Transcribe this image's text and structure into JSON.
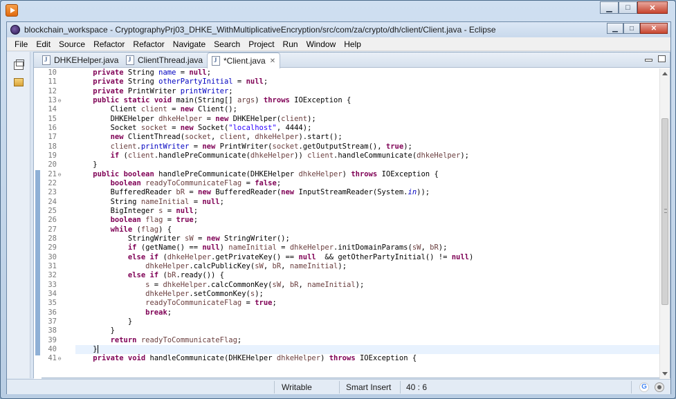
{
  "eclipse": {
    "title": "blockchain_workspace - CryptographyPrj03_DHKE_WithMultiplicativeEncryption/src/com/za/crypto/dh/client/Client.java - Eclipse"
  },
  "menu": [
    "File",
    "Edit",
    "Source",
    "Refactor",
    "Refactor",
    "Navigate",
    "Search",
    "Project",
    "Run",
    "Window",
    "Help"
  ],
  "tabs": [
    {
      "label": "DHKEHelper.java",
      "active": false
    },
    {
      "label": "ClientThread.java",
      "active": false
    },
    {
      "label": "*Client.java",
      "active": true,
      "close": "✕"
    }
  ],
  "editor": {
    "current_line": 40,
    "lines": [
      {
        "n": "10",
        "fold": "",
        "code": "    private String name = null;"
      },
      {
        "n": "11",
        "fold": "",
        "code": "    private String otherPartyInitial = null;"
      },
      {
        "n": "12",
        "fold": "",
        "code": "    private PrintWriter printWriter;"
      },
      {
        "n": "13",
        "fold": "⊖",
        "code": "    public static void main(String[] args) throws IOException {"
      },
      {
        "n": "14",
        "fold": "",
        "code": "        Client client = new Client();"
      },
      {
        "n": "15",
        "fold": "",
        "code": "        DHKEHelper dhkeHelper = new DHKEHelper(client);"
      },
      {
        "n": "16",
        "fold": "",
        "code": "        Socket socket = new Socket(\"localhost\", 4444);"
      },
      {
        "n": "17",
        "fold": "",
        "code": "        new ClientThread(socket, client, dhkeHelper).start();"
      },
      {
        "n": "18",
        "fold": "",
        "code": "        client.printWriter = new PrintWriter(socket.getOutputStream(), true);"
      },
      {
        "n": "19",
        "fold": "",
        "code": "        if (client.handlePreCommunicate(dhkeHelper)) client.handleCommunicate(dhkeHelper);"
      },
      {
        "n": "20",
        "fold": "",
        "code": "    }"
      },
      {
        "n": "21",
        "fold": "⊖",
        "code": "    public boolean handlePreCommunicate(DHKEHelper dhkeHelper) throws IOException {"
      },
      {
        "n": "22",
        "fold": "",
        "code": "        boolean readyToCommunicateFlag = false;"
      },
      {
        "n": "23",
        "fold": "",
        "code": "        BufferedReader bR = new BufferedReader(new InputStreamReader(System.in));"
      },
      {
        "n": "24",
        "fold": "",
        "code": "        String nameInitial = null;"
      },
      {
        "n": "25",
        "fold": "",
        "code": "        BigInteger s = null;"
      },
      {
        "n": "26",
        "fold": "",
        "code": "        boolean flag = true;"
      },
      {
        "n": "27",
        "fold": "",
        "code": "        while (flag) {"
      },
      {
        "n": "28",
        "fold": "",
        "code": "            StringWriter sW = new StringWriter();"
      },
      {
        "n": "29",
        "fold": "",
        "code": "            if (getName() == null) nameInitial = dhkeHelper.initDomainParams(sW, bR);"
      },
      {
        "n": "30",
        "fold": "",
        "code": "            else if (dhkeHelper.getPrivateKey() == null  && getOtherPartyInitial() != null)"
      },
      {
        "n": "31",
        "fold": "",
        "code": "                dhkeHelper.calcPublicKey(sW, bR, nameInitial);"
      },
      {
        "n": "32",
        "fold": "",
        "code": "            else if (bR.ready()) {"
      },
      {
        "n": "33",
        "fold": "",
        "code": "                s = dhkeHelper.calcCommonKey(sW, bR, nameInitial);"
      },
      {
        "n": "34",
        "fold": "",
        "code": "                dhkeHelper.setCommonKey(s);"
      },
      {
        "n": "35",
        "fold": "",
        "code": "                readyToCommunicateFlag = true;"
      },
      {
        "n": "36",
        "fold": "",
        "code": "                break;"
      },
      {
        "n": "37",
        "fold": "",
        "code": "            }"
      },
      {
        "n": "38",
        "fold": "",
        "code": "        }"
      },
      {
        "n": "39",
        "fold": "",
        "code": "        return readyToCommunicateFlag;"
      },
      {
        "n": "40",
        "fold": "",
        "code": "    }"
      },
      {
        "n": "41",
        "fold": "⊖",
        "code": "    private void handleCommunicate(DHKEHelper dhkeHelper) throws IOException {"
      }
    ]
  },
  "status": {
    "mode": "Writable",
    "insert": "Smart Insert",
    "position": "40 : 6"
  },
  "icons": {
    "outer_app": "recorder-app-icon",
    "eclipse": "eclipse-logo-icon",
    "trim_restore": "restore-icon",
    "trim_package": "package-explorer-icon",
    "java_file": "java-file-icon"
  }
}
